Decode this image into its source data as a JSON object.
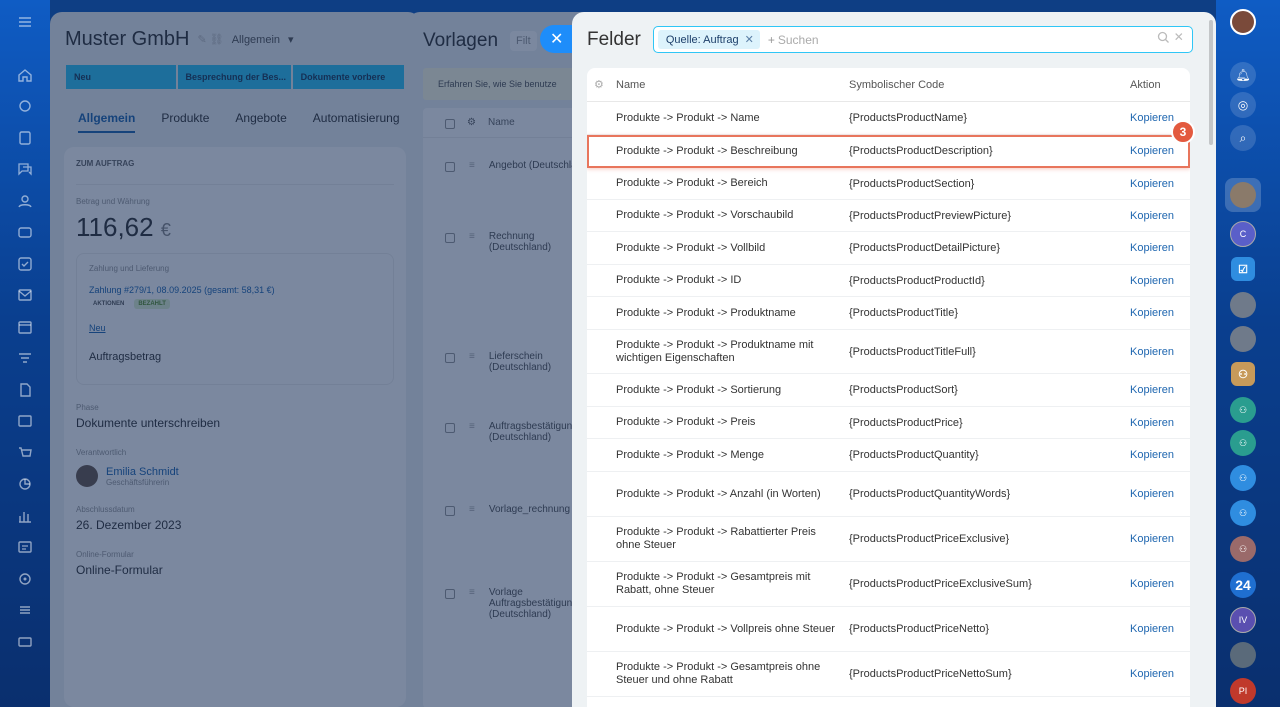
{
  "left_nav_icons": [
    "menu-icon",
    "home-icon",
    "feed-icon",
    "tasks-icon",
    "chat-icon",
    "contacts-icon",
    "crm-icon",
    "checklist-icon",
    "mail-icon",
    "calendar-icon",
    "filter-icon",
    "documents-icon",
    "sites-icon",
    "shop-icon",
    "analytics-icon",
    "reports-icon",
    "automation-icon",
    "settings-icon",
    "apps-icon",
    "more-icon"
  ],
  "deal": {
    "title": "Muster GmbH",
    "category": "Allgemein",
    "stages": [
      "Neu",
      "Besprechung der Bes...",
      "Dokumente vorbere"
    ],
    "tabs": [
      "Allgemein",
      "Produkte",
      "Angebote",
      "Automatisierung"
    ],
    "section": "ZUM AUFTRAG",
    "amount_label": "Betrag und Währung",
    "amount": "116,62",
    "currency": "€",
    "payment_label": "Zahlung und Lieferung",
    "payment_link": "Zahlung #279/1, 08.09.2025 (gesamt: 58,31 €)",
    "actions_badge": "AKTIONEN",
    "paid_badge": "BEZAHLT",
    "new_link": "Neu",
    "order_amount_label": "Auftragsbetrag",
    "phase_label": "Phase",
    "phase_value": "Dokumente unterschreiben",
    "responsible_label": "Verantwortlich",
    "person_name": "Emilia Schmidt",
    "person_role": "Geschäftsführerin",
    "date_label": "Abschlussdatum",
    "date_value": "26. Dezember 2023",
    "online_label": "Online-Formular",
    "online_value": "Online-Formular"
  },
  "templates": {
    "title": "Vorlagen",
    "filter": "Filt",
    "info": "Erfahren Sie, wie Sie benutze",
    "col_name": "Name",
    "items": [
      "Angebot (Deutschland)",
      "Rechnung (Deutschland)",
      "Lieferschein (Deutschland)",
      "Auftragsbestätigung (Deutschland)",
      "Vorlage_rechnung",
      "Vorlage Auftragsbestätigung (Deutschland)"
    ]
  },
  "fields": {
    "title": "Felder",
    "filter_chip": "Quelle: Auftrag",
    "search_placeholder": "Suchen",
    "columns": {
      "name": "Name",
      "code": "Symbolischer Code",
      "action": "Aktion"
    },
    "copy_label": "Kopieren",
    "marker": "3",
    "rows": [
      {
        "name": "Produkte -> Produkt -> Name",
        "code": "{ProductsProductName}"
      },
      {
        "name": "Produkte -> Produkt -> Beschreibung",
        "code": "{ProductsProductDescription}"
      },
      {
        "name": "Produkte -> Produkt -> Bereich",
        "code": "{ProductsProductSection}"
      },
      {
        "name": "Produkte -> Produkt -> Vorschaubild",
        "code": "{ProductsProductPreviewPicture}"
      },
      {
        "name": "Produkte -> Produkt -> Vollbild",
        "code": "{ProductsProductDetailPicture}"
      },
      {
        "name": "Produkte -> Produkt -> ID",
        "code": "{ProductsProductProductId}"
      },
      {
        "name": "Produkte -> Produkt -> Produktname",
        "code": "{ProductsProductTitle}"
      },
      {
        "name": "Produkte -> Produkt -> Produktname mit wichtigen Eigenschaften",
        "code": "{ProductsProductTitleFull}"
      },
      {
        "name": "Produkte -> Produkt -> Sortierung",
        "code": "{ProductsProductSort}"
      },
      {
        "name": "Produkte -> Produkt -> Preis",
        "code": "{ProductsProductPrice}"
      },
      {
        "name": "Produkte -> Produkt -> Menge",
        "code": "{ProductsProductQuantity}"
      },
      {
        "name": "Produkte -> Produkt -> Anzahl (in Worten)",
        "code": "{ProductsProductQuantityWords}"
      },
      {
        "name": "Produkte -> Produkt -> Rabattierter Preis ohne Steuer",
        "code": "{ProductsProductPriceExclusive}"
      },
      {
        "name": "Produkte -> Produkt -> Gesamtpreis mit Rabatt, ohne Steuer",
        "code": "{ProductsProductPriceExclusiveSum}"
      },
      {
        "name": "Produkte -> Produkt -> Vollpreis ohne Steuer",
        "code": "{ProductsProductPriceNetto}"
      },
      {
        "name": "Produkte -> Produkt -> Gesamtpreis ohne Steuer und ohne Rabatt",
        "code": "{ProductsProductPriceNettoSum}"
      }
    ]
  },
  "right_rail": {
    "badge_24": "24",
    "avatar_c": "C",
    "avatar_iv": "IV",
    "avatar_pl": "PI"
  },
  "colors": {
    "accent": "#2067b0",
    "highlight": "#e8755c",
    "search_border": "#2fc6f6",
    "stage": "#2fc6f6"
  }
}
